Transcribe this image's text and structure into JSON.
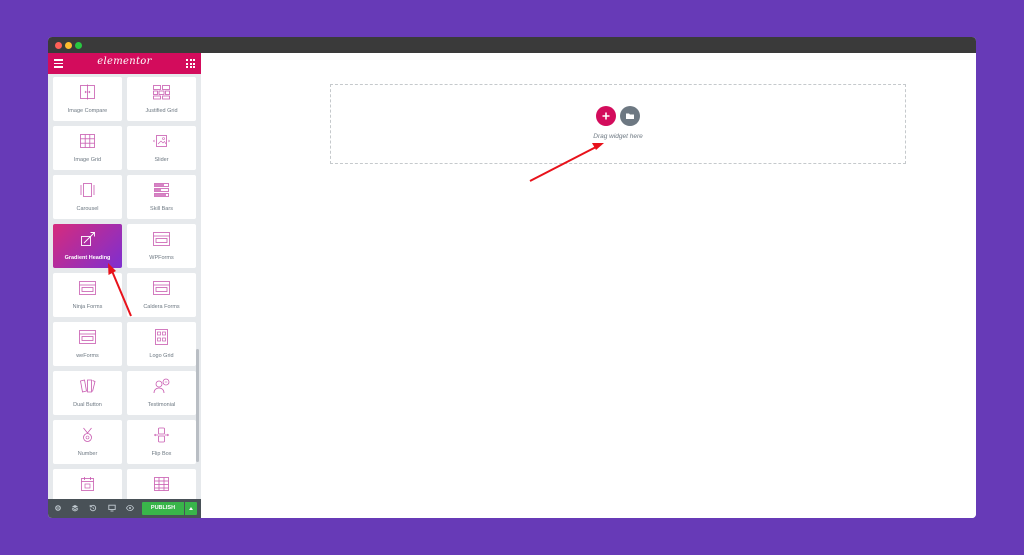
{
  "app": {
    "logo": "elementor"
  },
  "widgets": [
    {
      "label": "Image Compare",
      "icon": "image-compare-icon"
    },
    {
      "label": "Justified Grid",
      "icon": "justified-grid-icon"
    },
    {
      "label": "Image Grid",
      "icon": "image-grid-icon"
    },
    {
      "label": "Slider",
      "icon": "slider-icon"
    },
    {
      "label": "Carousel",
      "icon": "carousel-icon"
    },
    {
      "label": "Skill Bars",
      "icon": "skill-bars-icon"
    },
    {
      "label": "Gradient Heading",
      "icon": "gradient-heading-icon",
      "active": true
    },
    {
      "label": "WPForms",
      "icon": "form-icon"
    },
    {
      "label": "Ninja Forms",
      "icon": "form-icon"
    },
    {
      "label": "Caldera Forms",
      "icon": "form-icon"
    },
    {
      "label": "weForms",
      "icon": "form-icon"
    },
    {
      "label": "Logo Grid",
      "icon": "logo-grid-icon"
    },
    {
      "label": "Dual Button",
      "icon": "dual-button-icon"
    },
    {
      "label": "Testimonial",
      "icon": "testimonial-icon"
    },
    {
      "label": "Number",
      "icon": "number-icon"
    },
    {
      "label": "Flip Box",
      "icon": "flip-box-icon"
    },
    {
      "label": "",
      "icon": "calendar-icon"
    },
    {
      "label": "",
      "icon": "table-icon"
    }
  ],
  "footer": {
    "publish_label": "PUBLISH"
  },
  "canvas": {
    "drag_text": "Drag widget here"
  },
  "colors": {
    "brand": "#d30c5c",
    "publish": "#39b54a",
    "background": "#673ab7",
    "arrow": "#e8121b"
  }
}
